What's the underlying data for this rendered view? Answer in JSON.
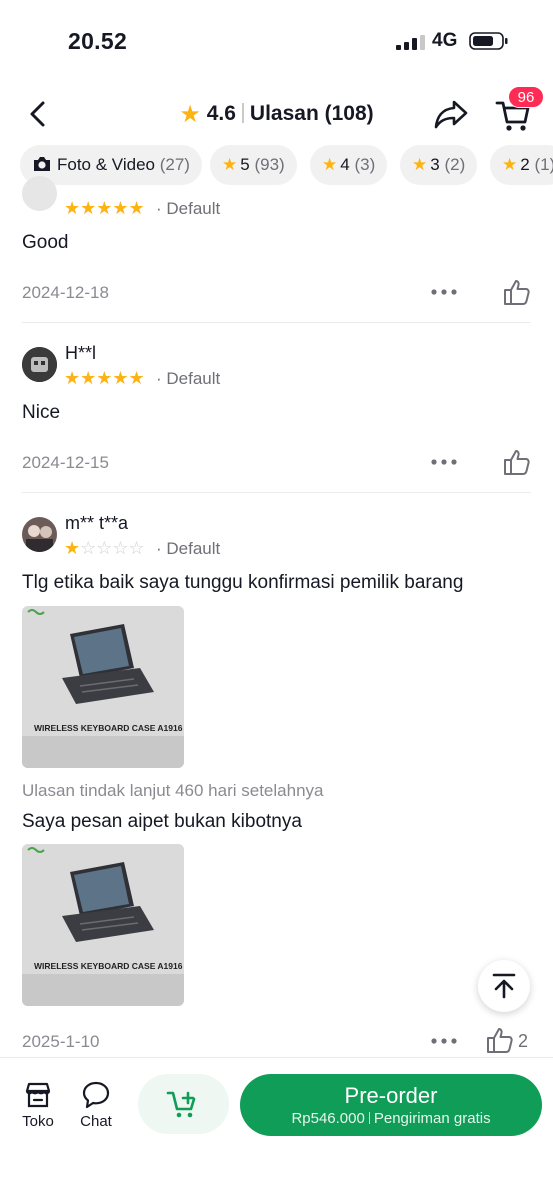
{
  "status_bar": {
    "time": "20.52",
    "network": "4G"
  },
  "header": {
    "rating": "4.6",
    "title": "Ulasan (108)",
    "cart_badge": "96"
  },
  "filters": [
    {
      "label": "Foto & Video",
      "count": "(27)",
      "icon": "camera-icon"
    },
    {
      "label": "5",
      "count": "(93)",
      "icon": "star-icon"
    },
    {
      "label": "4",
      "count": "(3)",
      "icon": "star-icon"
    },
    {
      "label": "3",
      "count": "(2)",
      "icon": "star-icon"
    },
    {
      "label": "2",
      "count": "(1)",
      "icon": "star-icon"
    }
  ],
  "reviews": [
    {
      "rating": 5,
      "variant": "Default",
      "text": "Good",
      "date": "2024-12-18"
    },
    {
      "username": "H**l",
      "rating": 5,
      "variant": "Default",
      "text": "Nice",
      "date": "2024-12-15"
    },
    {
      "username": "m** t**a",
      "rating": 1,
      "variant": "Default",
      "text": "Tlg etika baik saya tunggu konfirmasi pemilik barang",
      "photo_caption": "WIRELESS KEYBOARD CASE A1916",
      "followup_label": "Ulasan tindak lanjut 460 hari setelahnya",
      "followup_text": "Saya pesan aipet bukan kibotnya",
      "followup_photo_caption": "WIRELESS KEYBOARD CASE A1916",
      "date": "2025-1-10",
      "likes": "2"
    }
  ],
  "bottom_bar": {
    "shop_label": "Toko",
    "chat_label": "Chat",
    "preorder_label": "Pre-order",
    "price": "Rp546.000",
    "shipping": "Pengiriman gratis"
  },
  "colors": {
    "accent": "#0f9d58",
    "star": "#fcb314",
    "badge": "#fe2c55"
  }
}
